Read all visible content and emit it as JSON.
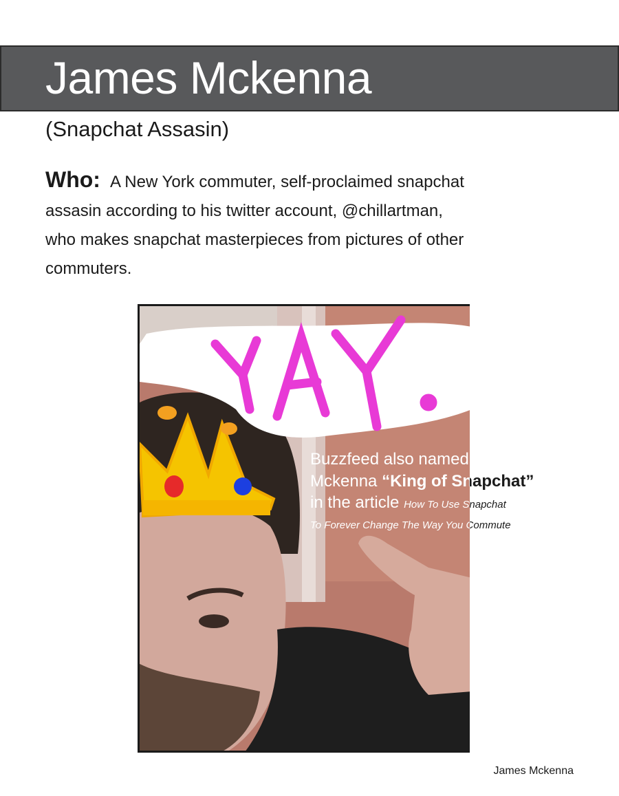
{
  "header": {
    "title": "James Mckenna",
    "subtitle": "(Snapchat Assasin)"
  },
  "who": {
    "label": "Who:",
    "text": "A New York commuter, self-proclaimed snapchat assasin according to his twitter account, @chillartman, who makes snapchat masterpieces from pictures of other commuters."
  },
  "photo": {
    "doodle_text": "YAY.",
    "doodle_color": "#e83ad6",
    "crown_color": "#f5c400"
  },
  "caption": {
    "line1": "Buzzfeed also named",
    "line2_prefix": "Mckenna ",
    "line2_bold": "“King of Snapchat”",
    "line3_prefix": "in the article ",
    "line3_title": "How To Use Snapchat",
    "line4": "To Forever Change The Way You Commute"
  },
  "footer": {
    "name": "James Mckenna"
  }
}
